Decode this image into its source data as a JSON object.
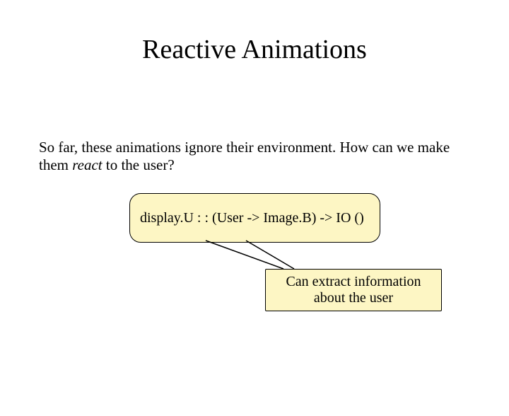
{
  "title": "Reactive Animations",
  "body": {
    "pre": "So far, these animations ignore their environment. How can we make them ",
    "emphasis": "react",
    "post": " to the user?"
  },
  "code": "display.U : : (User -> Image.B) -> IO ()",
  "callout": "Can extract information about the user"
}
